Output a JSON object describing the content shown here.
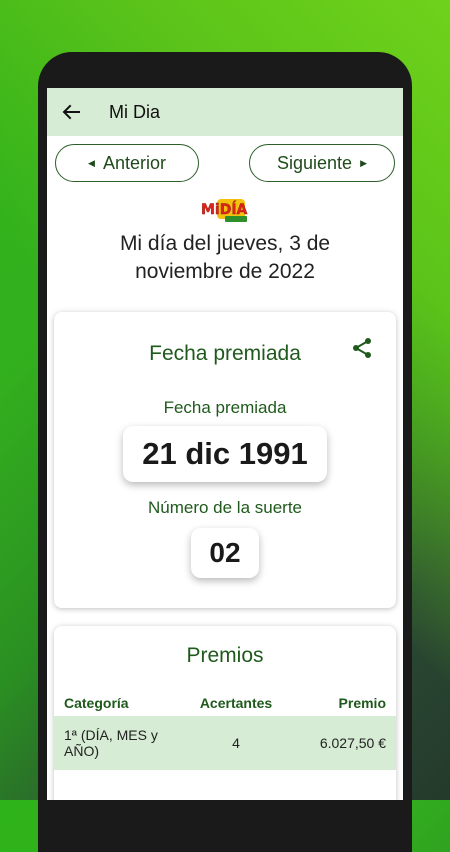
{
  "appbar": {
    "title": "Mi Dia"
  },
  "nav": {
    "prev_label": "Anterior",
    "next_label": "Siguiente"
  },
  "logo": {
    "text": "MiDÍA"
  },
  "draw": {
    "title": "Mi día del jueves, 3 de noviembre de 2022"
  },
  "winning": {
    "heading": "Fecha premiada",
    "date_label": "Fecha premiada",
    "date_value": "21 dic 1991",
    "lucky_label": "Número de la suerte",
    "lucky_value": "02"
  },
  "prizes": {
    "heading": "Premios",
    "columns": [
      "Categoría",
      "Acertantes",
      "Premio"
    ],
    "rows": [
      {
        "category": "1ª (DÍA, MES y AÑO)",
        "winners": "4",
        "prize": "6.027,50 €"
      }
    ]
  },
  "colors": {
    "accent": "#1f5a1c",
    "appbar": "#d6ecd4"
  }
}
